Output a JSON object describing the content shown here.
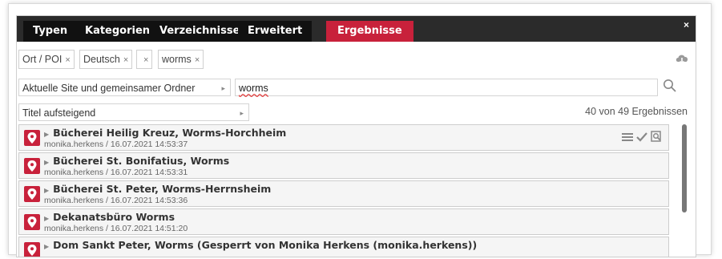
{
  "tabs": [
    "Typen",
    "Kategorien",
    "Verzeichnisse",
    "Erweitert",
    "Ergebnisse"
  ],
  "active_tab": "Ergebnisse",
  "close_label": "×",
  "chips": [
    {
      "label": "Ort / POI",
      "remove": "×"
    },
    {
      "label": "Deutsch",
      "remove": "×"
    },
    {
      "label": "",
      "remove": "×"
    },
    {
      "label": "worms",
      "remove": "×"
    }
  ],
  "scope": {
    "label": "Aktuelle Site und gemeinsamer Ordner",
    "arrow": "▸"
  },
  "search": {
    "value": "worms"
  },
  "sort": {
    "label": "Titel aufsteigend",
    "arrow": "▸"
  },
  "result_count": "40 von 49 Ergebnissen",
  "results": [
    {
      "title": "Bücherei Heilig Kreuz, Worms-Horchheim",
      "meta": "monika.herkens / 16.07.2021 14:53:37"
    },
    {
      "title": "Bücherei St. Bonifatius, Worms",
      "meta": "monika.herkens / 16.07.2021 14:53:31"
    },
    {
      "title": "Bücherei St. Peter, Worms-Herrnsheim",
      "meta": "monika.herkens / 16.07.2021 14:53:36"
    },
    {
      "title": "Dekanatsbüro Worms",
      "meta": "monika.herkens / 16.07.2021 14:51:20"
    },
    {
      "title": "Dom Sankt Peter, Worms (Gesperrt von Monika Herkens (monika.herkens))",
      "meta": ""
    }
  ],
  "colors": {
    "accent": "#c8213b",
    "tabbar": "#2b2b2b"
  }
}
